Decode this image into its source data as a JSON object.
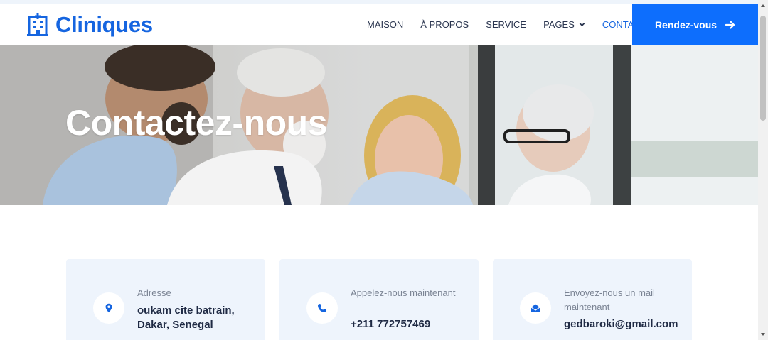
{
  "brand": {
    "name": "Cliniques",
    "icon": "hospital-icon"
  },
  "nav": {
    "items": [
      {
        "label": "MAISON",
        "active": false
      },
      {
        "label": "À PROPOS",
        "active": false
      },
      {
        "label": "SERVICE",
        "active": false
      },
      {
        "label": "PAGES",
        "active": false,
        "dropdown": true
      },
      {
        "label": "CONTACT",
        "active": true
      }
    ],
    "cta_label": "Rendez-vous"
  },
  "hero": {
    "title": "Contactez-nous"
  },
  "contact_cards": [
    {
      "icon": "map-pin-icon",
      "label": "Adresse",
      "value": "oukam cite batrain, Dakar, Senegal"
    },
    {
      "icon": "phone-icon",
      "label": "Appelez-nous maintenant",
      "value": "+211 772757469"
    },
    {
      "icon": "envelope-open-icon",
      "label": "Envoyez-nous un mail maintenant",
      "value": "gedbaroki@gmail.com"
    }
  ],
  "colors": {
    "primary": "#0d6efd",
    "brand": "#1565e0",
    "card_bg": "#eef4fc",
    "text_dark": "#1f2a44",
    "text_muted": "#7b8494"
  }
}
